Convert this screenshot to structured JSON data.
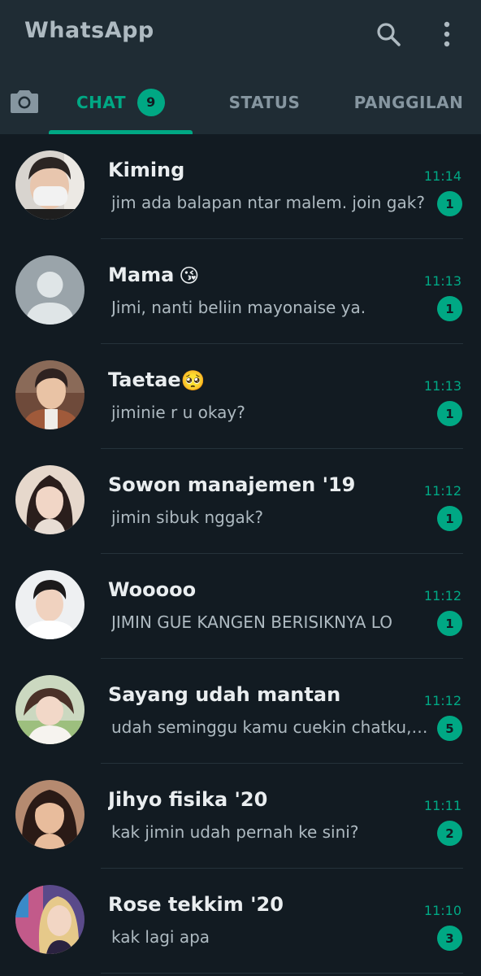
{
  "header": {
    "title": "WhatsApp",
    "search_icon": "search-icon",
    "menu_icon": "more-vert-icon"
  },
  "tabs": {
    "camera_icon": "camera-icon",
    "chat_label": "CHAT",
    "chat_badge": "9",
    "status_label": "STATUS",
    "calls_label": "PANGGILAN"
  },
  "colors": {
    "accent": "#00a884",
    "header_bg": "#1f2c34",
    "list_bg": "#121b22"
  },
  "chats": [
    {
      "name": "Kiming",
      "emoji": "",
      "message": "jim ada balapan ntar malem. join gak?",
      "time": "11:14",
      "unread": "1",
      "avatar": "photo-avatar"
    },
    {
      "name": "Mama",
      "emoji": "😘",
      "message": "Jimi, nanti beliin mayonaise ya.",
      "time": "11:13",
      "unread": "1",
      "avatar": "default-avatar"
    },
    {
      "name": "Taetae",
      "emoji": "🥺",
      "message": "jiminie r u okay?",
      "time": "11:13",
      "unread": "1",
      "avatar": "photo-avatar"
    },
    {
      "name": "Sowon manajemen '19",
      "emoji": "",
      "message": "jimin sibuk nggak?",
      "time": "11:12",
      "unread": "1",
      "avatar": "photo-avatar"
    },
    {
      "name": "Wooooo",
      "emoji": "",
      "message": "JIMIN GUE KANGEN BERISIKNYA LO",
      "time": "11:12",
      "unread": "1",
      "avatar": "photo-avatar"
    },
    {
      "name": "Sayang udah mantan",
      "emoji": "",
      "message": "udah seminggu kamu cuekin chatku, ...",
      "time": "11:12",
      "unread": "5",
      "avatar": "photo-avatar"
    },
    {
      "name": "Jihyo fisika '20",
      "emoji": "",
      "message": "kak jimin udah pernah ke sini?",
      "time": "11:11",
      "unread": "2",
      "avatar": "photo-avatar"
    },
    {
      "name": "Rose tekkim '20",
      "emoji": "",
      "message": "kak lagi apa",
      "time": "11:10",
      "unread": "3",
      "avatar": "photo-avatar"
    }
  ]
}
